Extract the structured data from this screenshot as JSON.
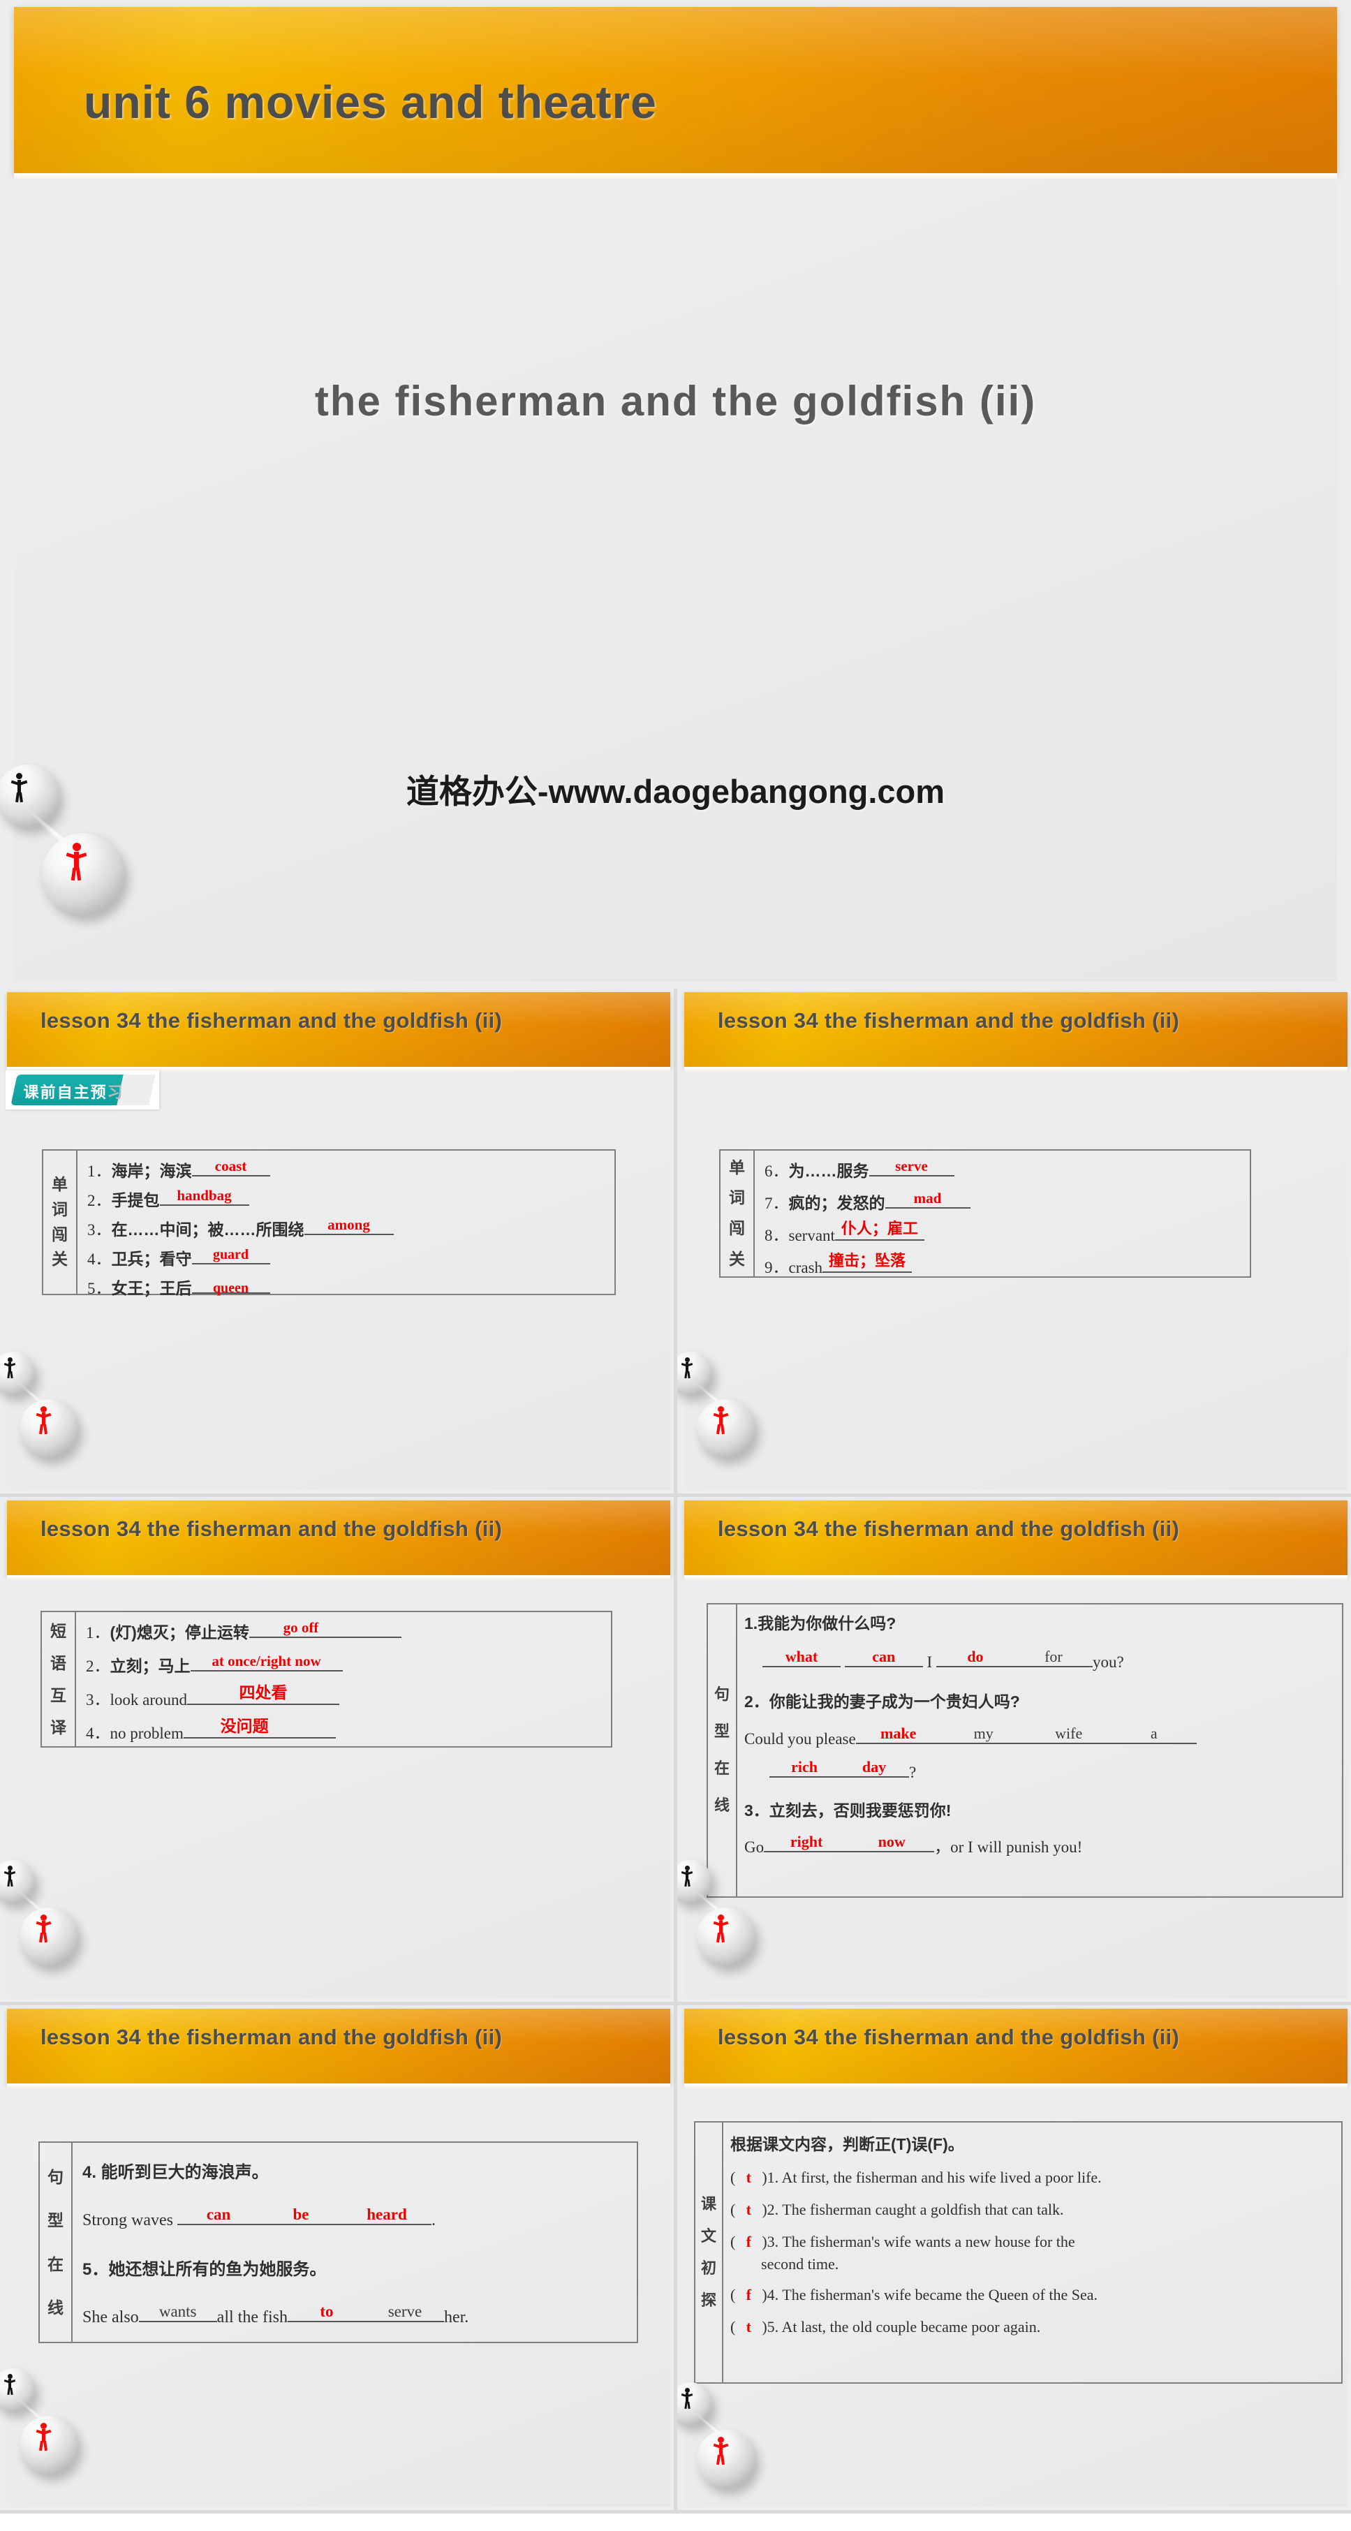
{
  "hero": {
    "band_title": "unit 6   movies and theatre",
    "subtitle": "the fisherman and the goldfish (ii)",
    "watermark": "道格办公-www.daogebangong.com"
  },
  "colors": {
    "accent_orange": "#e88a04",
    "accent_yellow": "#f5bb00",
    "answer_red": "#ee0000",
    "badge_teal": "#17b0ae",
    "slide_bg": "#eceded",
    "title_text": "#4d4d4d"
  },
  "slide_header": "lesson 34   the fisherman and the goldfish (ii)",
  "badge": {
    "text": "课前自主预习",
    "highlight": "课前自主预",
    "dim": "习"
  },
  "slides": [
    {
      "id": "slide-words-1",
      "side_label": "单词闯关",
      "side_chars": [
        "单",
        "词",
        "闯",
        "关"
      ],
      "rows": [
        {
          "num": "1．",
          "prompt": "海岸；海滨",
          "answer": "coast",
          "answer_lang": "en"
        },
        {
          "num": "2．",
          "prompt": "手提包",
          "answer": "handbag",
          "answer_lang": "en"
        },
        {
          "num": "3．",
          "prompt": "在……中间；被……所围绕",
          "answer": "among",
          "answer_lang": "en"
        },
        {
          "num": "4．",
          "prompt": "卫兵；看守",
          "answer": "guard",
          "answer_lang": "en"
        },
        {
          "num": "5．",
          "prompt": "女王；王后",
          "answer": "queen",
          "answer_lang": "en"
        }
      ]
    },
    {
      "id": "slide-words-2",
      "side_label": "单词闯关",
      "side_chars": [
        "单",
        "词",
        "闯",
        "关"
      ],
      "rows": [
        {
          "num": "6．",
          "prompt": "为……服务",
          "answer": "serve",
          "answer_lang": "en"
        },
        {
          "num": "7．",
          "prompt": "疯的；发怒的",
          "answer": "mad",
          "answer_lang": "en"
        },
        {
          "num": "8．",
          "prompt": "servant",
          "answer": "仆人；雇工",
          "answer_lang": "cn"
        },
        {
          "num": "9．",
          "prompt": "crash",
          "answer": "撞击；坠落",
          "answer_lang": "cn"
        }
      ]
    },
    {
      "id": "slide-phrases",
      "side_label": "短语互译",
      "side_chars": [
        "短",
        "语",
        "互",
        "译"
      ],
      "rows": [
        {
          "num": "1．",
          "prompt": "(灯)熄灭；停止运转",
          "answer": "go off",
          "answer_lang": "en"
        },
        {
          "num": "2．",
          "prompt": "立刻；马上",
          "answer": "at once/right now",
          "answer_lang": "en"
        },
        {
          "num": "3．",
          "prompt": "look around",
          "answer": "四处看",
          "answer_lang": "cn"
        },
        {
          "num": "4．",
          "prompt": "no problem",
          "answer": "没问题",
          "answer_lang": "cn"
        }
      ]
    },
    {
      "id": "slide-sentences-1",
      "side_label": "句型在线",
      "side_chars": [
        "句",
        "型",
        "在",
        "线"
      ],
      "items": [
        {
          "cn": "1.我能为你做什么吗?",
          "en_parts": [
            {
              "type": "blank",
              "answer": "what",
              "color": "red",
              "w": 128
            },
            {
              "type": "blank",
              "answer": "can",
              "color": "red",
              "w": 128
            },
            {
              "type": "text",
              "text": " I "
            },
            {
              "type": "blank",
              "answer": "do",
              "color": "red",
              "w": 128
            },
            {
              "type": "blank",
              "answer": "for",
              "color": "black",
              "w": 128
            },
            {
              "type": "text",
              "text": "you?"
            }
          ]
        },
        {
          "cn": "2．你能让我的妻子成为一个贵妇人吗?",
          "en_parts": [
            {
              "type": "text",
              "text": "Could you please"
            },
            {
              "type": "blank",
              "answer": "make",
              "color": "red",
              "w": 128
            },
            {
              "type": "blank",
              "answer": "my",
              "color": "black",
              "w": 128
            },
            {
              "type": "blank",
              "answer": "wife",
              "color": "black",
              "w": 128
            },
            {
              "type": "blank",
              "answer": "a",
              "color": "black",
              "w": 128
            }
          ],
          "en_parts2": [
            {
              "type": "blank",
              "answer": "rich",
              "color": "red",
              "w": 112
            },
            {
              "type": "blank",
              "answer": "day",
              "color": "red",
              "w": 112
            },
            {
              "type": "text",
              "text": "?"
            }
          ]
        },
        {
          "cn": "3．立刻去，否则我要惩罚你!",
          "en_parts": [
            {
              "type": "text",
              "text": "Go"
            },
            {
              "type": "blank",
              "answer": "right",
              "color": "red",
              "w": 128
            },
            {
              "type": "blank",
              "answer": "now",
              "color": "red",
              "w": 128
            },
            {
              "type": "text",
              "text": "，or I will punish you!"
            }
          ]
        }
      ]
    },
    {
      "id": "slide-sentences-2",
      "side_label": "句型在线",
      "side_chars": [
        "句",
        "型",
        "在",
        "线"
      ],
      "items": [
        {
          "cn": "4. 能听到巨大的海浪声。",
          "en_parts": [
            {
              "type": "text",
              "text": "Strong waves"
            },
            {
              "type": "blank",
              "answer": "can",
              "color": "red",
              "w": 128
            },
            {
              "type": "blank",
              "answer": "be",
              "color": "red",
              "w": 128
            },
            {
              "type": "blank",
              "answer": "heard",
              "color": "red",
              "w": 128
            },
            {
              "type": "text",
              "text": "."
            }
          ]
        },
        {
          "cn": "5．她还想让所有的鱼为她服务。",
          "en_parts": [
            {
              "type": "text",
              "text": "She also"
            },
            {
              "type": "blank",
              "answer": "wants",
              "color": "black",
              "w": 120
            },
            {
              "type": "text",
              "text": "all the fish"
            },
            {
              "type": "blank",
              "answer": "to",
              "color": "red",
              "w": 120
            },
            {
              "type": "blank",
              "answer": "serve",
              "color": "black",
              "w": 120
            },
            {
              "type": "text",
              "text": "her."
            }
          ]
        }
      ]
    },
    {
      "id": "slide-text-check",
      "side_label": "课文初探",
      "side_chars": [
        "课",
        "文",
        "初",
        "探"
      ],
      "instruction": "根据课文内容，判断正(T)误(F)。",
      "tf_items": [
        {
          "mark": "t",
          "text": ")1. At first, the fisherman and his wife lived a poor life."
        },
        {
          "mark": "t",
          "text": ")2. The fisherman caught a goldfish that can talk."
        },
        {
          "mark": "f",
          "text": ")3. The fisherman's wife wants a new house for the"
        },
        {
          "mark": "",
          "text": "second time.",
          "continuation": true
        },
        {
          "mark": "f",
          "text": ")4. The fisherman's wife became the Queen of the Sea."
        },
        {
          "mark": "t",
          "text": ")5. At last, the old couple became poor again."
        }
      ]
    }
  ]
}
